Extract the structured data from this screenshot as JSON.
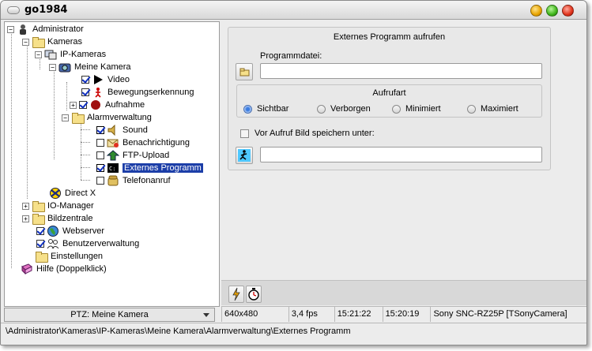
{
  "window": {
    "title": "go1984"
  },
  "tree": {
    "root": "Administrator",
    "kameras": "Kameras",
    "ip_kameras": "IP-Kameras",
    "meine_kamera": "Meine Kamera",
    "video": "Video",
    "bewegung": "Bewegungserkennung",
    "aufnahme": "Aufnahme",
    "alarm": "Alarmverwaltung",
    "sound": "Sound",
    "benachrichtigung": "Benachrichtigung",
    "ftp": "FTP-Upload",
    "externes": "Externes Programm",
    "telefon": "Telefonanruf",
    "directx": "Direct X",
    "io_manager": "IO-Manager",
    "bildzentrale": "Bildzentrale",
    "webserver": "Webserver",
    "benutzer": "Benutzerverwaltung",
    "einstellungen": "Einstellungen",
    "hilfe": "Hilfe (Doppelklick)"
  },
  "ptz": {
    "label": "PTZ: Meine Kamera"
  },
  "panel": {
    "title": "Externes Programm aufrufen",
    "programmdatei_label": "Programmdatei:",
    "programmdatei_value": "",
    "aufrufart_title": "Aufrufart",
    "radios": [
      "Sichtbar",
      "Verborgen",
      "Minimiert",
      "Maximiert"
    ],
    "selected_radio": "Sichtbar",
    "save_label": "Vor Aufruf Bild speichern unter:",
    "save_checked": false,
    "save_path_value": ""
  },
  "status": {
    "empty": "",
    "resolution": "640x480",
    "fps": "3,4 fps",
    "time1": "15:21:22",
    "time2": "15:20:19",
    "camera": "Sony SNC-RZ25P [TSonyCamera]"
  },
  "path": "\\Administrator\\Kameras\\IP-Kameras\\Meine Kamera\\Alarmverwaltung\\Externes Programm"
}
